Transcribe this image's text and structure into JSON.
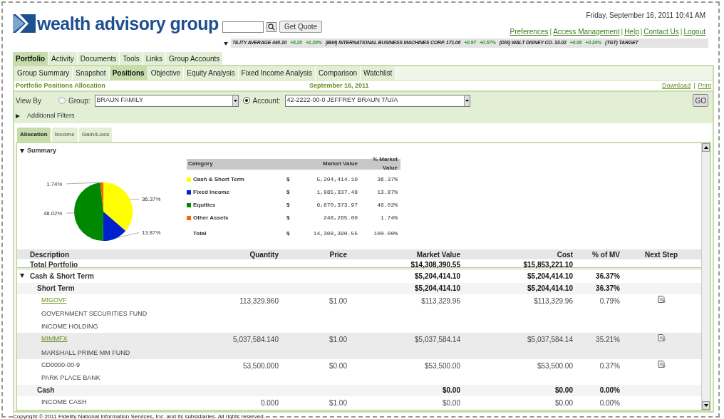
{
  "header": {
    "logo_text": "wealth advisory group",
    "quote_button": "Get Quote",
    "datetime": "Friday, September 16, 2011 10:41 AM",
    "links": [
      "Preferences",
      "Access Management",
      "Help",
      "Contact Us",
      "Logout"
    ],
    "link_separator": "|",
    "ticker": [
      {
        "text": "TILITY AVERAGE  440.10",
        "change": "+5.20",
        "pct": "+1.20%"
      },
      {
        "text": "(IBM) INTERNATIONAL BUSINESS MACHINES CORP. 171.06",
        "change": "+0.97",
        "pct": "+0.57%"
      },
      {
        "text": "(DIS) WALT DISNEY CO. 33.02",
        "change": "+0.08",
        "pct": "+0.24%"
      },
      {
        "text": "(TGT) TARGET"
      }
    ]
  },
  "nav_tabs": [
    {
      "label": "Portfolio",
      "selected": true
    },
    {
      "label": "Activity",
      "selected": false
    },
    {
      "label": "Documents",
      "selected": false
    },
    {
      "label": "Tools",
      "selected": false
    },
    {
      "label": "Links",
      "selected": false
    },
    {
      "label": "Group Accounts",
      "selected": false
    }
  ],
  "sub_tabs": [
    {
      "label": "Group Summary",
      "selected": false
    },
    {
      "label": "Snapshot",
      "selected": false
    },
    {
      "label": "Positions",
      "selected": true
    },
    {
      "label": "Objective",
      "selected": false
    },
    {
      "label": "Equity Analysis",
      "selected": false
    },
    {
      "label": "Fixed Income Analysis",
      "selected": false
    },
    {
      "label": "Comparison",
      "selected": false
    },
    {
      "label": "Watchlist",
      "selected": false
    }
  ],
  "page_title": "Portfolio Positions Allocation",
  "page_date": "September 16, 2011",
  "page_links": [
    "Download",
    "Print"
  ],
  "page_link_separator": "|",
  "view_by": {
    "label": "View By",
    "options": [
      {
        "label": "Group:",
        "selected": false,
        "value": "BRAUN FAMILY"
      },
      {
        "label": "Account:",
        "selected": true,
        "value": "42-2222-00-0 JEFFREY BRAUN T/U/A"
      }
    ],
    "go_button": "GO"
  },
  "additional_filters": {
    "label": "Additional Filters",
    "expanded": false
  },
  "content_tabs": [
    {
      "label": "Allocation",
      "selected": true
    },
    {
      "label": "Income",
      "selected": false
    },
    {
      "label": "Gain/Loss",
      "selected": false
    }
  ],
  "summary": {
    "title": "Summary",
    "expanded": true,
    "chart_data": {
      "type": "pie",
      "categories": [
        "Cash & Short Term",
        "Fixed Income",
        "Equities",
        "Other Assets"
      ],
      "values": [
        36.37,
        13.87,
        48.02,
        1.74
      ],
      "value_labels": [
        "36.37%",
        "13.87%",
        "48.02%",
        "1.74%"
      ]
    },
    "columns": [
      "Category",
      "Market Value",
      "% Market Value"
    ],
    "rows": [
      {
        "color": "#ffff00",
        "currency": "$",
        "market_value": "5,204,414.10",
        "pct": "36.37%"
      },
      {
        "color": "#0022cc",
        "currency": "$",
        "market_value": "1,985,337.48",
        "pct": "13.87%"
      },
      {
        "color": "#008800",
        "currency": "$",
        "market_value": "6,870,373.97",
        "pct": "48.02%"
      },
      {
        "color": "#ff6600",
        "currency": "$",
        "market_value": "248,265.00",
        "pct": "1.74%"
      }
    ],
    "total": {
      "label": "Total",
      "currency": "$",
      "market_value": "14,308,390.55",
      "pct": "100.00%"
    }
  },
  "positions": {
    "columns": [
      "Description",
      "Quantity",
      "Price",
      "Market Value",
      "Cost",
      "% of MV",
      "Next Step"
    ],
    "rows": [
      {
        "kind": "total",
        "description": "Total Portfolio",
        "market_value": "$14,308,390.55",
        "cost": "$15,853,221.10"
      },
      {
        "kind": "group",
        "description": "Cash & Short Term",
        "expanded": true,
        "market_value": "$5,204,414.10",
        "cost": "$5,204,414.10",
        "pct": "36.37%"
      },
      {
        "kind": "subgroup",
        "description": "Short Term",
        "market_value": "$5,204,414.10",
        "cost": "$5,204,414.10",
        "pct": "36.37%"
      },
      {
        "kind": "security",
        "symbol": "MIGOVF",
        "link": true,
        "names": [
          "GOVERNMENT SECURITIES FUND",
          "INCOME HOLDING"
        ],
        "quantity": "113,329.960",
        "price": "$1.00",
        "market_value": "$113,329.96",
        "cost": "$113,329.96",
        "pct": "0.79%",
        "shaded": false
      },
      {
        "kind": "security",
        "symbol": "MIMMFX",
        "link": true,
        "names": [
          "MARSHALL PRIME MM FUND"
        ],
        "quantity": "5,037,584.140",
        "price": "$1.00",
        "market_value": "$5,037,584.14",
        "cost": "$5,037,584.14",
        "pct": "35.21%",
        "shaded": true
      },
      {
        "kind": "security",
        "symbol": "CD0000-00-9",
        "link": false,
        "names": [
          "PARK PLACE BANK"
        ],
        "quantity": "53,500.000",
        "price": "$0.00",
        "market_value": "$53,500.00",
        "cost": "$53,500.00",
        "pct": "0.37%",
        "shaded": false
      },
      {
        "kind": "subgroup",
        "description": "Cash",
        "market_value": "$0.00",
        "cost": "$0.00",
        "pct": "0.00%"
      },
      {
        "kind": "security",
        "names": [
          "INCOME CASH"
        ],
        "quantity": "0.000",
        "price": "$1.00",
        "market_value": "$0.00",
        "cost": "$0.00",
        "pct": "0.00%",
        "shaded": false
      }
    ]
  },
  "footer": "Copyright © 2011 Fidelity National Information Services, Inc. and its subsidiaries. All rights reserved."
}
